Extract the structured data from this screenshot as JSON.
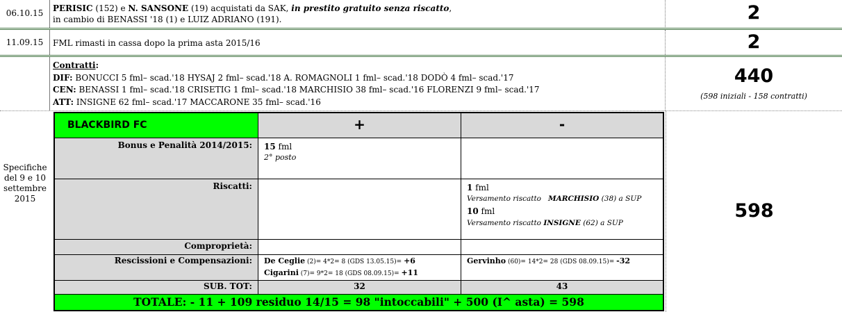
{
  "rows": [
    {
      "date": "06.10.15",
      "line1": {
        "name1": "PERISIC",
        "num1": " (152) e ",
        "name2": "N. SANSONE",
        "num2": " (19) acquistati da SAK, ",
        "italic": "in prestito gratuito senza riscatto",
        "tail": ","
      },
      "line2": "in cambio di BENASSI '18 (1) e LUIZ ADRIANO (191).",
      "value": "2"
    },
    {
      "date": "11.09.15",
      "text": "FML rimasti in cassa dopo la prima asta 2015/16",
      "value": "2"
    }
  ],
  "contracts": {
    "title": "Contratti",
    "title_colon": ":",
    "dif_label": "DIF:",
    "dif_text": " BONUCCI 5 fml– scad.'18  HYSAJ 2 fml– scad.'18  A. ROMAGNOLI 1 fml– scad.'18  DODÒ 4 fml– scad.'17",
    "cen_label": "CEN:",
    "cen_text": "  BENASSI 1 fml– scad.'18  CRISETIG 1 fml– scad.'18   MARCHISIO 38 fml– scad.'16  FLORENZI 9 fml– scad.'17",
    "att_label": "ATT:",
    "att_text": "  INSIGNE 62 fml– scad.'17  MACCARONE 35 fml– scad.'16",
    "value": "440",
    "note": "(598 iniziali - 158 contratti)"
  },
  "specs": {
    "date_label": [
      "Specifiche",
      "del 9 e 10",
      "settembre",
      "2015"
    ],
    "value": "598"
  },
  "table": {
    "team": "BLACKBIRD FC",
    "plus": "+",
    "minus": "-",
    "bonus": {
      "label": "Bonus e Penalità 2014/2015:",
      "plus_amount": "15",
      "plus_unit": " fml",
      "plus_note": "2° posto"
    },
    "riscatti": {
      "label": "Riscatti:",
      "m1_amount": "1",
      "m1_unit": " fml",
      "m1_pre": "Versamento riscatto   ",
      "m1_name": "MARCHISIO",
      "m1_post": " (38) a SUP",
      "m2_amount": "10",
      "m2_unit": " fml",
      "m2_pre": "Versamento riscatto ",
      "m2_name": "INSIGNE",
      "m2_post": " (62) a SUP"
    },
    "comproprieta": {
      "label": "Comproprietà:"
    },
    "rescissioni": {
      "label": "Rescissioni e Compensazioni:",
      "p1_name": "De Ceglie",
      "p1_detail": " (2)= 4*2= 8 (GDS 13.05.15)= ",
      "p1_val": "+6",
      "p2_name": "Cigarini",
      "p2_detail": " (7)= 9*2= 18 (GDS 08.09.15)= ",
      "p2_val": "+11",
      "m1_name": "Gervinho",
      "m1_detail": " (60)= 14*2= 28 (GDS 08.09.15)= ",
      "m1_val": "-32"
    },
    "subtot": {
      "label": "SUB. TOT:",
      "plus": "32",
      "minus": "43"
    },
    "totale": "TOTALE: - 11 + 109 residuo 14/15 = 98 \"intoccabili\" + 500 (I^ asta) = 598"
  },
  "colors": {
    "header_green": "#00ff00",
    "gray": "#d9d9d9"
  }
}
